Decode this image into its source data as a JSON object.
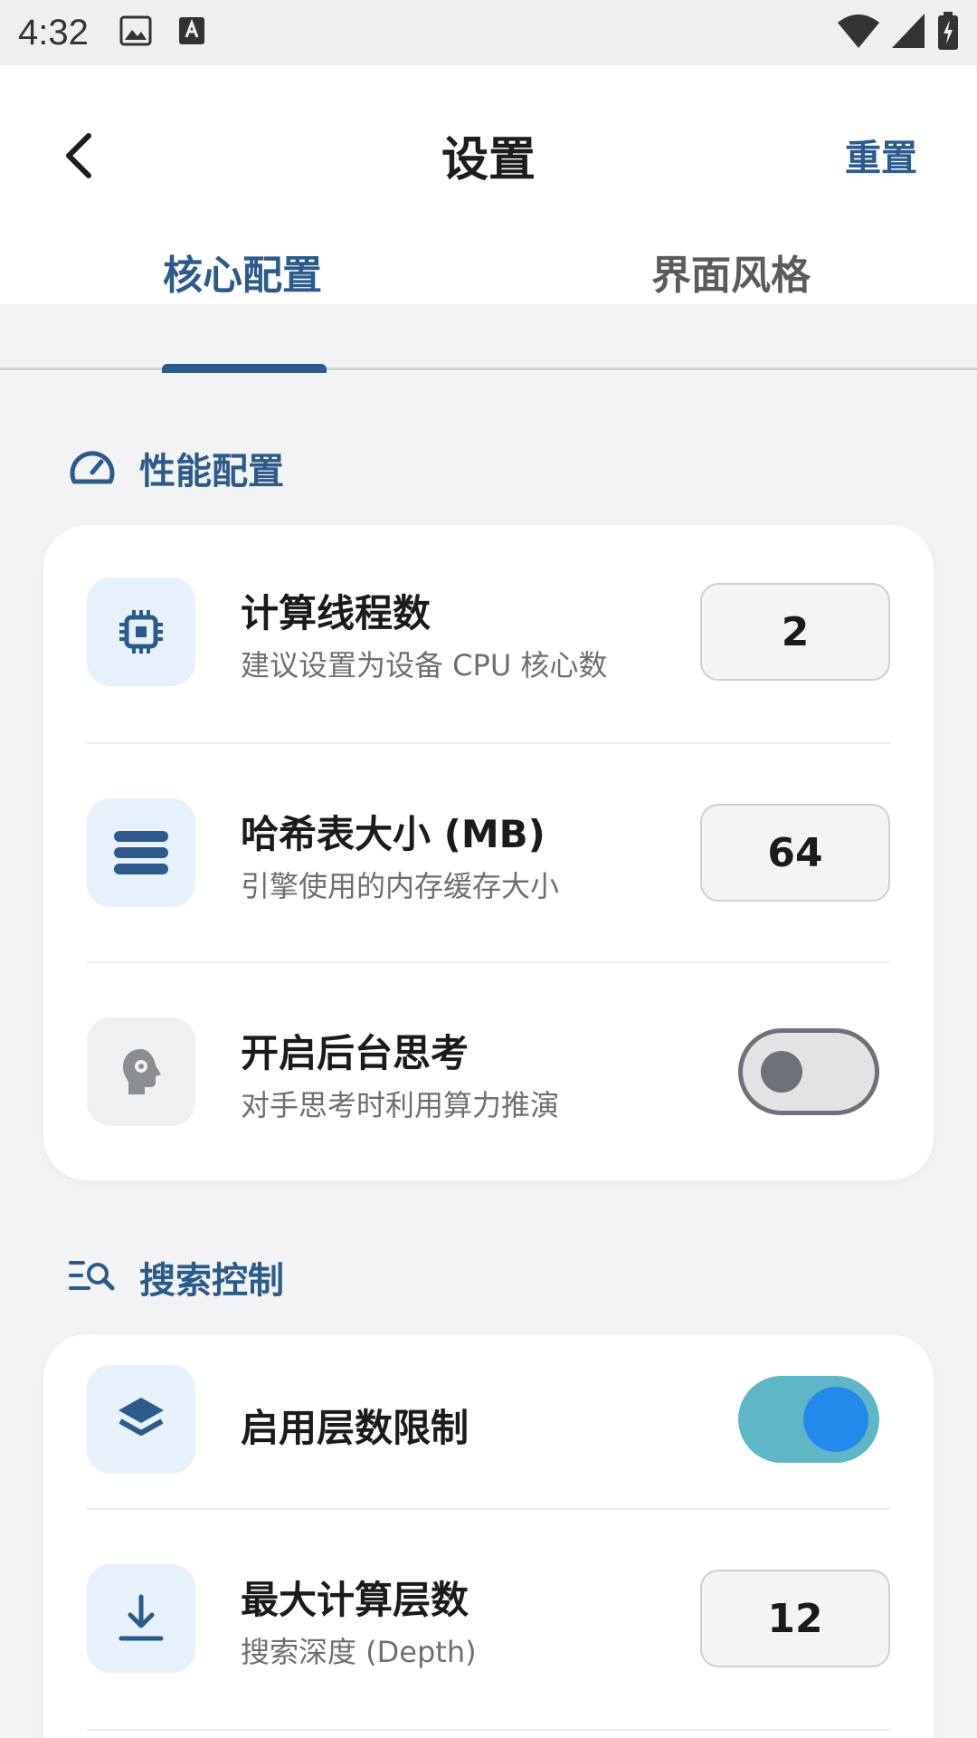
{
  "status_bar": {
    "time": "4:32",
    "icons": [
      "image-icon",
      "keyboard-a-icon",
      "wifi-icon",
      "signal-icon",
      "battery-charging-icon"
    ]
  },
  "app_bar": {
    "title": "设置",
    "reset_label": "重置",
    "back_icon": "chevron-left-icon"
  },
  "tabs": [
    {
      "label": "核心配置",
      "active": true
    },
    {
      "label": "界面风格",
      "active": false
    }
  ],
  "sections": {
    "performance": {
      "title": "性能配置",
      "icon": "speedometer-icon",
      "rows": [
        {
          "title": "计算线程数",
          "subtitle": "建议设置为设备 CPU 核心数",
          "value": "2",
          "icon": "cpu-icon"
        },
        {
          "title": "哈希表大小 (MB)",
          "subtitle": "引擎使用的内存缓存大小",
          "value": "64",
          "icon": "storage-icon"
        },
        {
          "title": "开启后台思考",
          "subtitle": "对手思考时利用算力推演",
          "toggle": false,
          "icon": "head-gear-icon"
        }
      ]
    },
    "search": {
      "title": "搜索控制",
      "icon": "list-search-icon",
      "rows": [
        {
          "title": "启用层数限制",
          "toggle": true,
          "icon": "layers-icon"
        },
        {
          "title": "最大计算层数",
          "subtitle": "搜索深度 (Depth)",
          "value": "12",
          "icon": "download-arrow-icon"
        }
      ]
    }
  },
  "colors": {
    "accent": "#2c5a8a",
    "toggle_on_track": "#5fb6c6",
    "toggle_on_knob": "#2389ea",
    "icon_bg": "#e6f1fb"
  }
}
